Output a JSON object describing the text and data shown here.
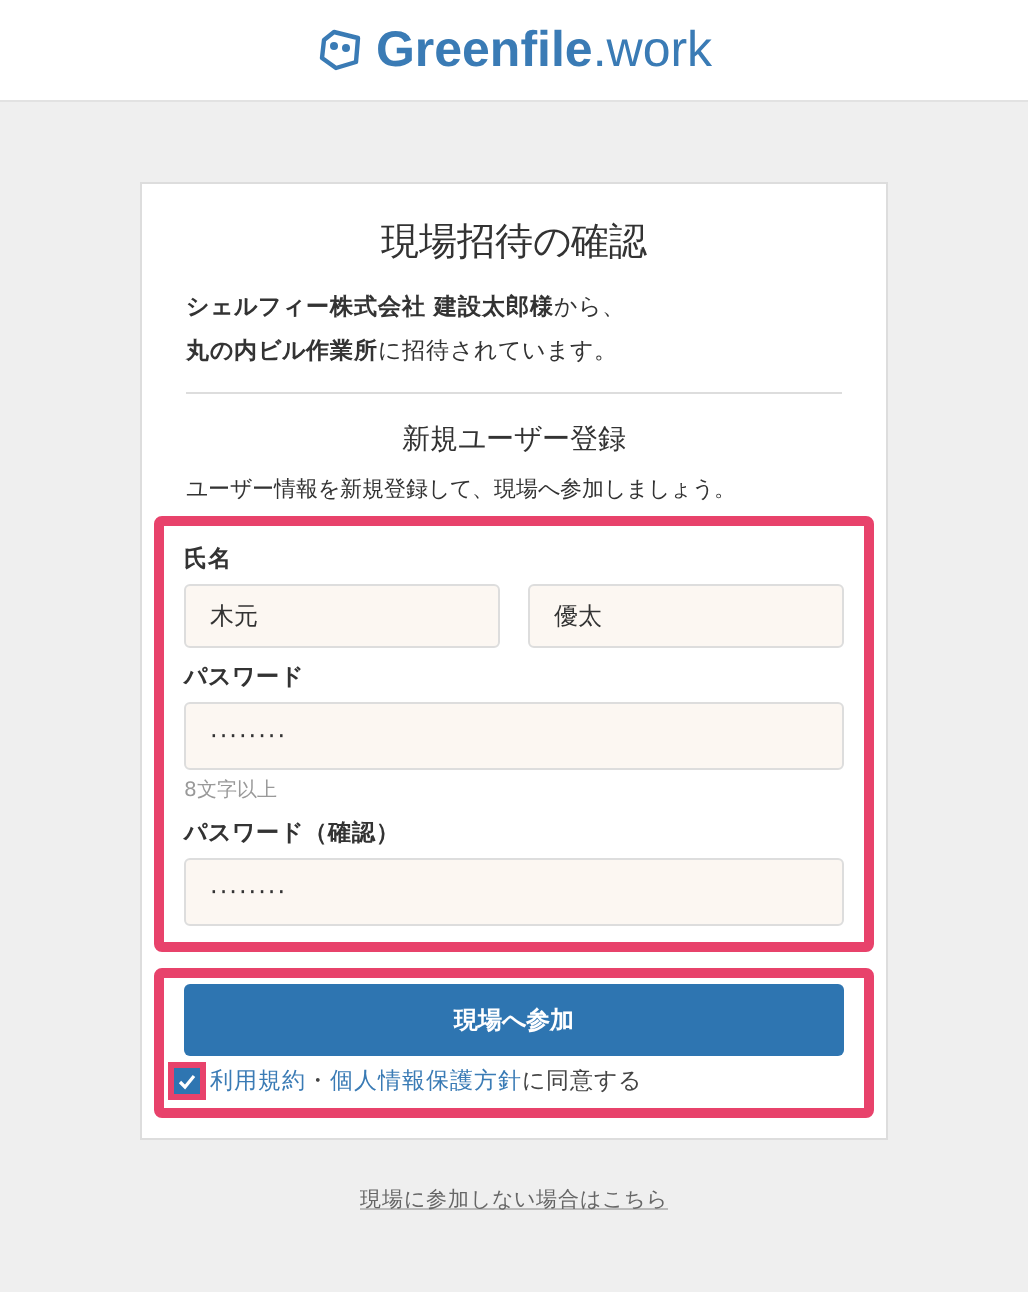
{
  "header": {
    "logo_text": "Greenfile",
    "logo_suffix": ".work"
  },
  "card": {
    "title": "現場招待の確認",
    "invitation": "**シェルフィー株式会社 建設太郎様**から、",
    "invitation_2": "**丸の内ビル作業所**に招待されています。",
    "subtitle": "新規ユーザー登録",
    "description": "ユーザー情報を新規登録して、現場へ参加しましょう。",
    "fields": [
      {
        "label": "氏名",
        "values": [
          "木元",
          "優太"
        ]
      },
      {
        "label": "パスワード",
        "values": [
          "········"
        ],
        "hint": "8文字以上"
      },
      {
        "label": "パスワード（確認）",
        "values": [
          "········"
        ]
      }
    ],
    "submit": "現場へ参加",
    "agree": {
      "checked": true,
      "links": [
        "利用規約",
        "個人情報保護方針"
      ],
      "separator": "・",
      "text": "に同意する"
    }
  },
  "footer_link": "現場に参加しない場合はこちら"
}
